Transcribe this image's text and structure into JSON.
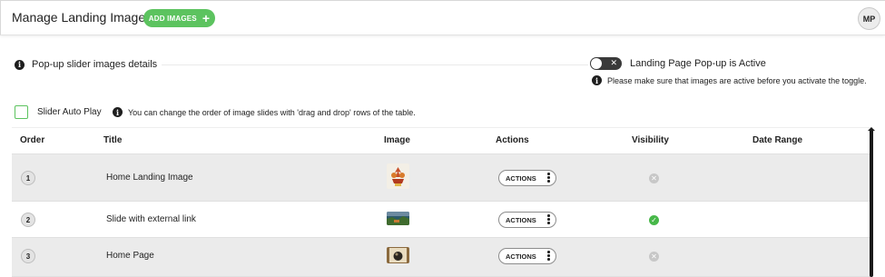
{
  "header": {
    "title": "Manage Landing Images",
    "add_button_label": "ADD IMAGES",
    "add_button_icon": "plus-icon",
    "avatar_initials": "MP"
  },
  "popup": {
    "section_label": "Pop-up slider images details",
    "toggle_label": "Landing Page Pop-up is Active",
    "toggle_state": "off",
    "toggle_note": "Please make sure that images are active before you activate the toggle."
  },
  "slider": {
    "autoplay_label": "Slider Auto Play",
    "autoplay_checked": false,
    "drag_note": "You can change the order of image slides with 'drag and drop' rows of the table."
  },
  "table": {
    "columns": [
      "Order",
      "Title",
      "Image",
      "Actions",
      "Visibility",
      "Date Range"
    ],
    "rows": [
      {
        "order": "1",
        "title": "Home Landing Image",
        "actions_label": "ACTIONS",
        "visible": false,
        "date_range": ""
      },
      {
        "order": "2",
        "title": "Slide with external link",
        "actions_label": "ACTIONS",
        "visible": true,
        "date_range": ""
      },
      {
        "order": "3",
        "title": "Home Page",
        "actions_label": "ACTIONS",
        "visible": false,
        "date_range": ""
      }
    ]
  },
  "colors": {
    "accent_green": "#5cc35f",
    "visible_green": "#47b849",
    "hidden_gray": "#c7c7c7",
    "row_alt": "#ebebeb"
  }
}
